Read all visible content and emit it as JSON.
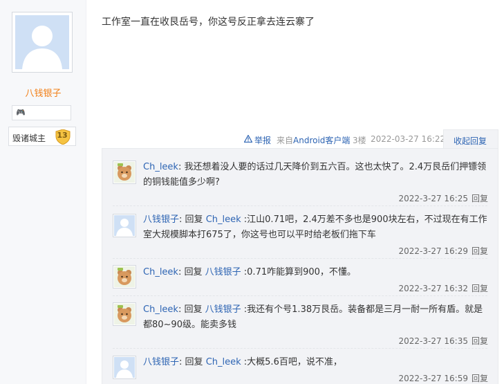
{
  "author": {
    "name": "八钱银子",
    "badge_icon": "game-controller-icon",
    "title": "毁诸城主",
    "level": "13"
  },
  "post": {
    "content": "工作室一直在收艮岳号，你这号反正拿去连云寨了",
    "report_label": "举报",
    "source_prefix": "来自",
    "source_client": "Android客户端",
    "floor": "3楼",
    "time": "2022-03-27 16:22",
    "collapse_label": "收起回复"
  },
  "replies": [
    {
      "user": "Ch_leek",
      "avatar": "bear-avatar",
      "reply_word": "",
      "reply_to": "",
      "text": "我还想着没人要的话过几天降价到五六百。这也太快了。2.4万艮岳们押镖领的铜钱能值多少啊?",
      "time": "2022-3-27 16:25",
      "reply_label": "回复"
    },
    {
      "user": "八钱银子",
      "avatar": "default-avatar",
      "reply_word": "回复",
      "reply_to": "Ch_leek",
      "text": ":江山0.71吧，2.4万差不多也是900块左右，不过现在有工作室大规模脚本打675了，你这号也可以平时给老板们拖下车",
      "time": "2022-3-27 16:29",
      "reply_label": "回复"
    },
    {
      "user": "Ch_leek",
      "avatar": "bear-avatar",
      "reply_word": "回复",
      "reply_to": "八钱银子",
      "text": ":0.71咋能算到900，不懂。",
      "time": "2022-3-27 16:32",
      "reply_label": "回复"
    },
    {
      "user": "Ch_leek",
      "avatar": "bear-avatar",
      "reply_word": "回复",
      "reply_to": "八钱银子",
      "text": ":我还有个号1.38万艮岳。装备都是三月一耐一所有盾。就是都80~90级。能卖多钱",
      "time": "2022-3-27 16:35",
      "reply_label": "回复"
    },
    {
      "user": "八钱银子",
      "avatar": "default-avatar",
      "reply_word": "回复",
      "reply_to": "Ch_leek",
      "text": ":大概5.6百吧，说不准，",
      "time": "2022-3-27 16:59",
      "reply_label": "回复"
    }
  ]
}
